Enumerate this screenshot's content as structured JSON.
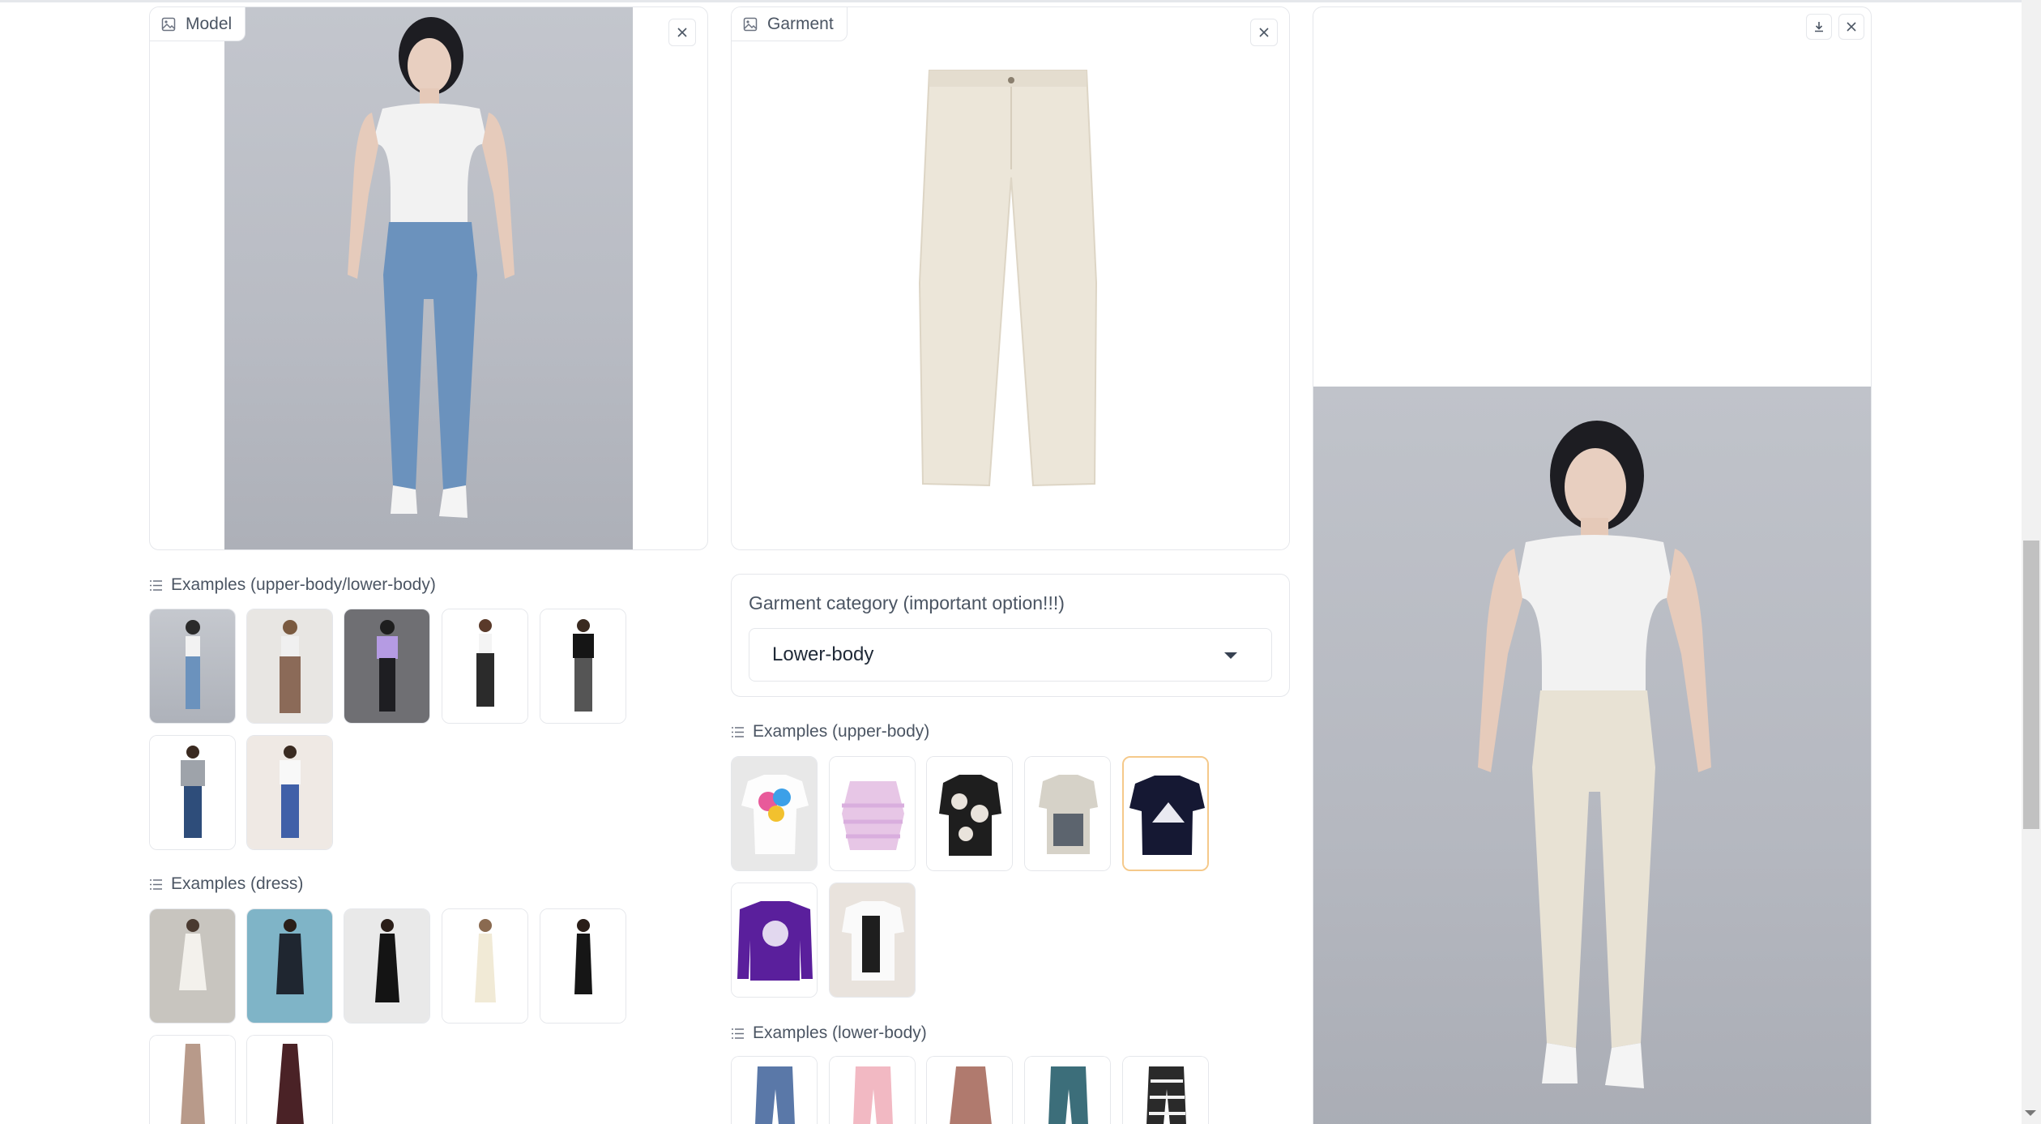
{
  "model_panel": {
    "label": "Model"
  },
  "garment_panel": {
    "label": "Garment"
  },
  "result_panel": {},
  "examples_upper_lower": {
    "title": "Examples (upper-body/lower-body)"
  },
  "examples_dress": {
    "title": "Examples (dress)"
  },
  "garment_category": {
    "label": "Garment category (important option!!!)",
    "selected": "Lower-body"
  },
  "examples_upper": {
    "title": "Examples (upper-body)"
  },
  "examples_lower": {
    "title": "Examples (lower-body)"
  },
  "icons": {
    "image": "image-icon",
    "close": "close-icon",
    "download": "download-icon",
    "list": "list-icon",
    "dropdown": "chevron-down-icon"
  },
  "colors": {
    "border": "#e5e7eb",
    "selected_border": "#f5c98a",
    "photo_bg": "#b8bbc3"
  }
}
